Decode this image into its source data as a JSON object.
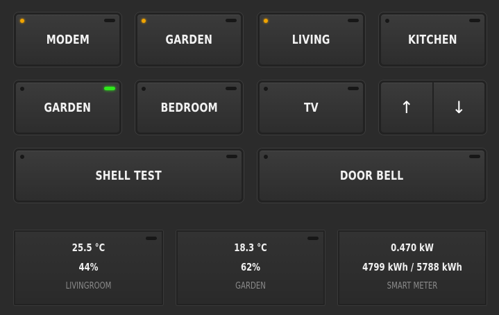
{
  "buttons_row1": [
    {
      "label": "MODEM",
      "led": true
    },
    {
      "label": "GARDEN",
      "led": true
    },
    {
      "label": "LIVING",
      "led": true
    },
    {
      "label": "KITCHEN",
      "led": false
    }
  ],
  "buttons_row2": [
    {
      "label": "GARDEN",
      "led": false,
      "indicator": "green"
    },
    {
      "label": "BEDROOM",
      "led": false
    },
    {
      "label": "TV",
      "led": false
    }
  ],
  "blinds": {
    "up": "↑",
    "down": "↓"
  },
  "buttons_row3": [
    {
      "label": "SHELL TEST"
    },
    {
      "label": "DOOR BELL"
    }
  ],
  "sensors": [
    {
      "line1": "25.5 °C",
      "line2": "44%",
      "name": "LIVINGROOM"
    },
    {
      "line1": "18.3 °C",
      "line2": "62%",
      "name": "GARDEN"
    },
    {
      "line1": "0.470 kW",
      "line2": "4799 kWh / 5788 kWh",
      "name": "SMART METER"
    }
  ],
  "colors": {
    "background": "#2b2b2b",
    "led_on": "#f0a400",
    "indicator_green": "#2fe81c"
  }
}
